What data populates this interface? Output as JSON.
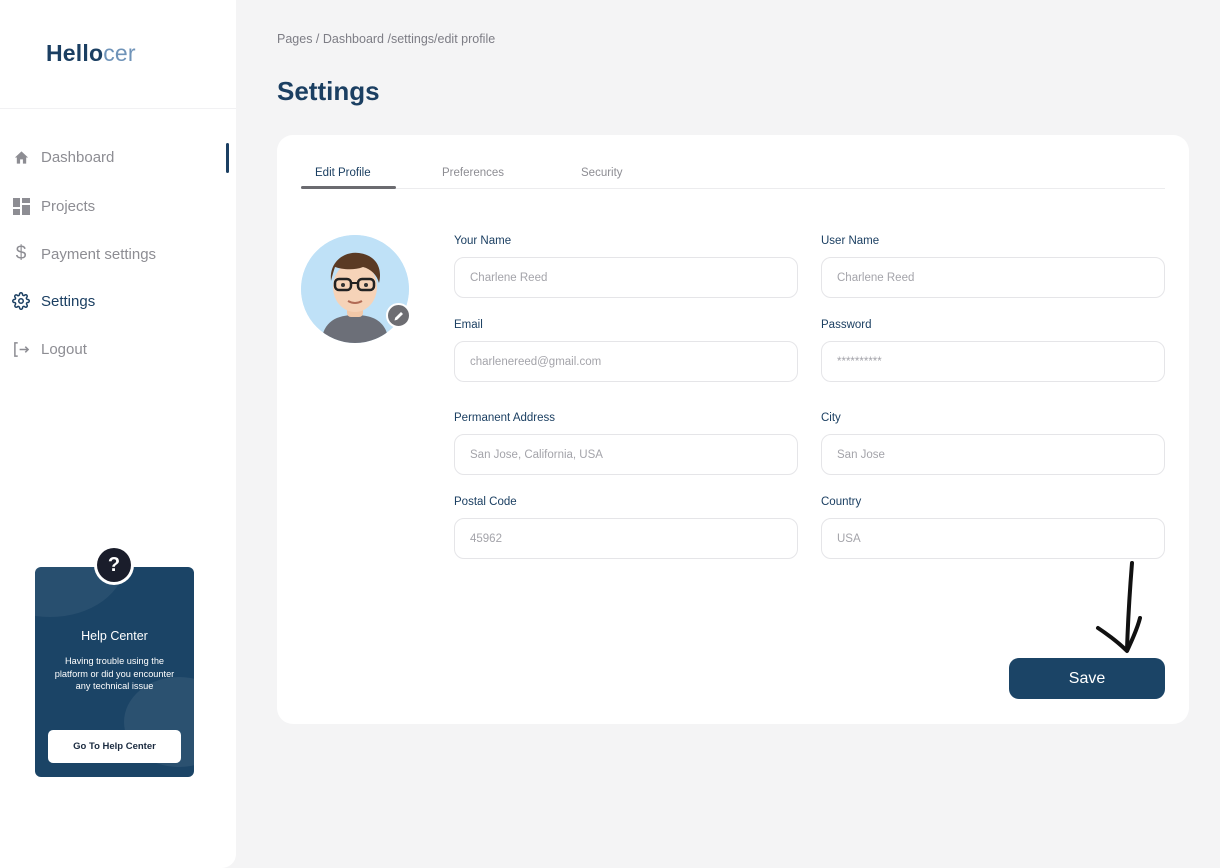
{
  "brand": {
    "name_bold": "Hello",
    "name_light": "cer"
  },
  "sidebar": {
    "items": [
      {
        "label": "Dashboard",
        "icon": "home-icon"
      },
      {
        "label": "Projects",
        "icon": "grid-icon"
      },
      {
        "label": "Payment settings",
        "icon": "dollar-icon"
      },
      {
        "label": "Settings",
        "icon": "gear-icon",
        "active": true
      },
      {
        "label": "Logout",
        "icon": "logout-icon"
      }
    ]
  },
  "help": {
    "icon": "question-icon",
    "title": "Help Center",
    "text": "Having trouble using the platform or did you encounter any technical issue",
    "button": "Go To Help Center"
  },
  "breadcrumb": "Pages / Dashboard /settings/edit profile",
  "page_title": "Settings",
  "tabs": [
    {
      "label": "Edit Profile",
      "active": true
    },
    {
      "label": "Preferences"
    },
    {
      "label": "Security"
    }
  ],
  "form": {
    "your_name": {
      "label": "Your Name",
      "placeholder": "Charlene Reed"
    },
    "user_name": {
      "label": "User Name",
      "placeholder": "Charlene Reed"
    },
    "email": {
      "label": "Email",
      "placeholder": "charlenereed@gmail.com"
    },
    "password": {
      "label": "Password",
      "placeholder": "**********"
    },
    "address": {
      "label": "Permanent Address",
      "placeholder": "San Jose, California, USA"
    },
    "city": {
      "label": "City",
      "placeholder": "San Jose"
    },
    "postal": {
      "label": "Postal Code",
      "placeholder": "45962"
    },
    "country": {
      "label": "Country",
      "placeholder": "USA"
    }
  },
  "save_label": "Save",
  "colors": {
    "primary": "#1b4466",
    "accent_text": "#1b3f62",
    "background": "#f4f4f5"
  }
}
